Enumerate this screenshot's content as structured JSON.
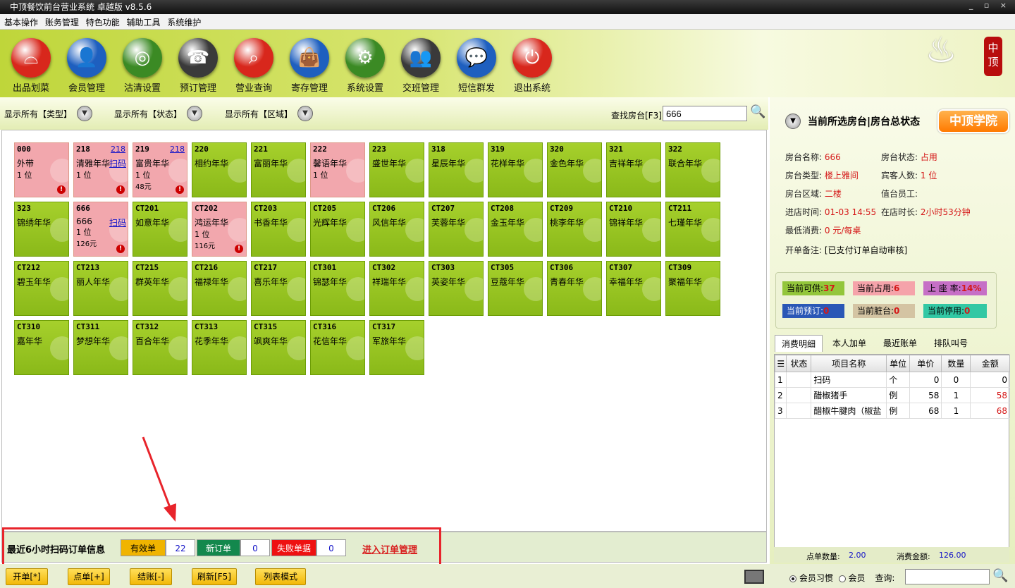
{
  "window": {
    "title": "中顶餐饮前台营业系统 卓越版 v8.5.6",
    "controls": "_ ▫ ×"
  },
  "menu": [
    "基本操作",
    "账务管理",
    "特色功能",
    "辅助工具",
    "系统维护"
  ],
  "toolbar": [
    {
      "label": "出品划菜",
      "icon": "cloche-icon",
      "color": "#d8271c"
    },
    {
      "label": "会员管理",
      "icon": "member-icon",
      "color": "#1e5fbf"
    },
    {
      "label": "沽清设置",
      "icon": "plate-icon",
      "color": "#3b8a24"
    },
    {
      "label": "预订管理",
      "icon": "phone-icon",
      "color": "#3a3a3a"
    },
    {
      "label": "营业查询",
      "icon": "magnifier-icon",
      "color": "#d8271c"
    },
    {
      "label": "寄存管理",
      "icon": "bag-icon",
      "color": "#1e5fbf"
    },
    {
      "label": "系统设置",
      "icon": "gear-icon",
      "color": "#3b8a24"
    },
    {
      "label": "交班管理",
      "icon": "people-icon",
      "color": "#3a3a3a"
    },
    {
      "label": "短信群发",
      "icon": "chat-icon",
      "color": "#1e5fbf"
    },
    {
      "label": "退出系统",
      "icon": "power-icon",
      "color": "#d8271c"
    }
  ],
  "logo": {
    "seal_text": "中顶"
  },
  "filters": {
    "type": "显示所有【类型】",
    "status": "显示所有【状态】",
    "area": "显示所有【区域】"
  },
  "search": {
    "label": "查找房台[F3]",
    "value": "666"
  },
  "tiles": [
    {
      "code": "000",
      "name": "外带",
      "seats": "1 位",
      "occ": true,
      "alert": true
    },
    {
      "code": "218",
      "name": "清雅年华",
      "seats": "1 位",
      "occ": true,
      "link": "218",
      "scan": "扫码",
      "alert": true
    },
    {
      "code": "219",
      "name": "富贵年华",
      "seats": "1 位",
      "amount": "48元",
      "occ": true,
      "link": "218",
      "alert": true
    },
    {
      "code": "220",
      "name": "相约年华"
    },
    {
      "code": "221",
      "name": "富丽年华"
    },
    {
      "code": "222",
      "name": "馨语年华",
      "seats": "1 位",
      "occ": true
    },
    {
      "code": "223",
      "name": "盛世年华"
    },
    {
      "code": "318",
      "name": "星辰年华"
    },
    {
      "code": "319",
      "name": "花样年华"
    },
    {
      "code": "320",
      "name": "金色年华"
    },
    {
      "code": "321",
      "name": "吉祥年华"
    },
    {
      "code": "322",
      "name": "联合年华"
    },
    {
      "code": "323",
      "name": "锦绣年华"
    },
    {
      "code": "666",
      "name": "666",
      "seats": "1 位",
      "amount": "126元",
      "occ": true,
      "scan": "扫码",
      "alert": true
    },
    {
      "code": "CT201",
      "name": "如意年华"
    },
    {
      "code": "CT202",
      "name": "鸿运年华",
      "seats": "1 位",
      "amount": "116元",
      "occ": true,
      "alert": true
    },
    {
      "code": "CT203",
      "name": "书香年华"
    },
    {
      "code": "CT205",
      "name": "光辉年华"
    },
    {
      "code": "CT206",
      "name": "风信年华"
    },
    {
      "code": "CT207",
      "name": "芙蓉年华"
    },
    {
      "code": "CT208",
      "name": "金玉年华"
    },
    {
      "code": "CT209",
      "name": "桃李年华"
    },
    {
      "code": "CT210",
      "name": "锦祥年华"
    },
    {
      "code": "CT211",
      "name": "七瑾年华"
    },
    {
      "code": "CT212",
      "name": "碧玉年华"
    },
    {
      "code": "CT213",
      "name": "丽人年华"
    },
    {
      "code": "CT215",
      "name": "群英年华"
    },
    {
      "code": "CT216",
      "name": "福禄年华"
    },
    {
      "code": "CT217",
      "name": "喜乐年华"
    },
    {
      "code": "CT301",
      "name": "锦瑟年华"
    },
    {
      "code": "CT302",
      "name": "祥瑞年华"
    },
    {
      "code": "CT303",
      "name": "英姿年华"
    },
    {
      "code": "CT305",
      "name": "豆蔻年华"
    },
    {
      "code": "CT306",
      "name": "青春年华"
    },
    {
      "code": "CT307",
      "name": "幸福年华"
    },
    {
      "code": "CT309",
      "name": "聚福年华"
    },
    {
      "code": "CT310",
      "name": "嘉年华"
    },
    {
      "code": "CT311",
      "name": "梦想年华"
    },
    {
      "code": "CT312",
      "name": "百合年华"
    },
    {
      "code": "CT313",
      "name": "花季年华"
    },
    {
      "code": "CT315",
      "name": "飒爽年华"
    },
    {
      "code": "CT316",
      "name": "花信年华"
    },
    {
      "code": "CT317",
      "name": "军旅年华"
    }
  ],
  "tile_watermark": "中顶",
  "scan_orders": {
    "title": "最近6小时扫码订单信息",
    "valid_label": "有效单",
    "valid_count": "22",
    "new_label": "新订单",
    "new_count": "0",
    "fail_label": "失败单据",
    "fail_count": "0",
    "manage_link": "进入订单管理"
  },
  "bottom_buttons": [
    "开单[*]",
    "点单[+]",
    "结账[-]",
    "刷新[F5]",
    "列表模式"
  ],
  "right": {
    "header": "当前所选房台|房台总状态",
    "academy": "中顶学院",
    "info": {
      "name_k": "房台名称:",
      "name_v": "666",
      "status_k": "房台状态:",
      "status_v": "占用",
      "type_k": "房台类型:",
      "type_v": "楼上雅间",
      "guests_k": "宾客人数:",
      "guests_v": "1 位",
      "area_k": "房台区域:",
      "area_v": "二楼",
      "staff_k": "值台员工:",
      "staff_v": "",
      "in_k": "进店时间:",
      "in_v": "01-03 14:55",
      "dur_k": "在店时长:",
      "dur_v": "2小时53分钟",
      "min_k": "最低消费:",
      "min_v": "0 元/每桌",
      "note_k": "开单备注:",
      "note_v": "[已支付订单自动审核]"
    },
    "stats": {
      "avail_k": "当前可供:",
      "avail_v": "37",
      "occ_k": "当前占用:",
      "occ_v": "6",
      "rate_k": "上 座 率:",
      "rate_v": "14%",
      "book_k": "当前预订:",
      "book_v": "0",
      "dirty_k": "当前脏台:",
      "dirty_v": "0",
      "stop_k": "当前停用:",
      "stop_v": "0"
    },
    "tabs": [
      "消费明细",
      "本人加单",
      "最近账单",
      "排队叫号"
    ],
    "columns": [
      "状态",
      "项目名称",
      "单位",
      "单价",
      "数量",
      "金额"
    ],
    "rows": [
      {
        "n": "1",
        "name": "扫码",
        "unit": "个",
        "price": "0",
        "qty": "0",
        "amt": "0"
      },
      {
        "n": "2",
        "name": "醋椒猪手",
        "unit": "例",
        "price": "58",
        "qty": "1",
        "amt": "58"
      },
      {
        "n": "3",
        "name": "醋椒牛腱肉（椒盐",
        "unit": "例",
        "price": "68",
        "qty": "1",
        "amt": "68"
      }
    ],
    "footer": {
      "qty_k": "点单数量:",
      "qty_v": "2.00",
      "total_k": "消费金额:",
      "total_v": "126.00"
    },
    "member": {
      "opt1": "会员习惯",
      "opt2": "会员",
      "query": "查询:"
    }
  },
  "colors": {
    "tile_free": "#96c323",
    "tile_occ": "#f2a7ad",
    "highlight": "#e8242b"
  }
}
